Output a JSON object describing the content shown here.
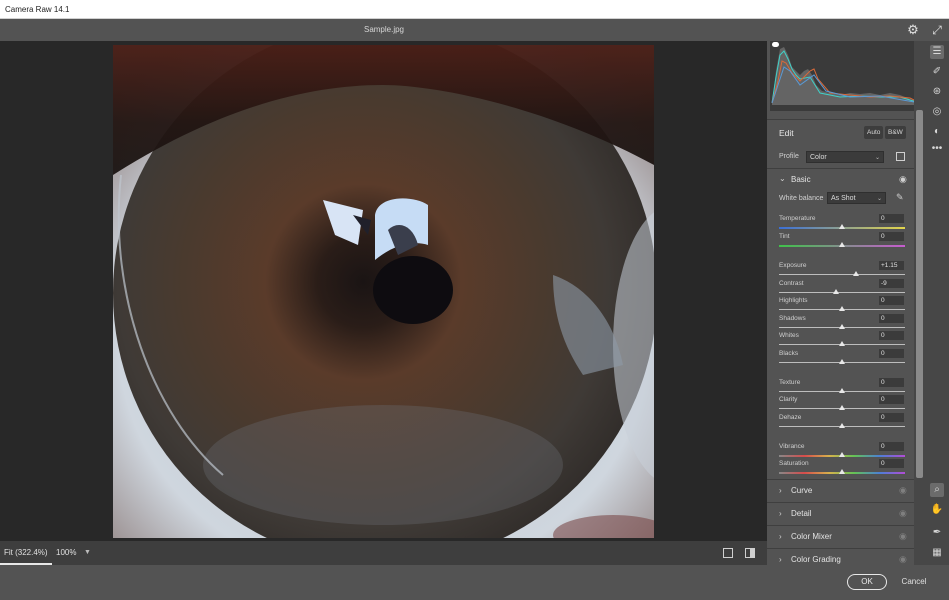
{
  "window": {
    "title": "Camera Raw 14.1"
  },
  "header": {
    "filename": "Sample.jpg",
    "settings_icon": "gear-icon",
    "fullscreen_icon": "expand-icon"
  },
  "bottombar": {
    "zoom_fit": "Fit (322.4%)",
    "zoom_level": "100%"
  },
  "footer": {
    "ok": "OK",
    "cancel": "Cancel"
  },
  "panel": {
    "edit_title": "Edit",
    "auto_label": "Auto",
    "bw_label": "B&W",
    "profile_label": "Profile",
    "profile_value": "Color",
    "basic_section": "Basic",
    "white_balance_label": "White balance",
    "white_balance_value": "As Shot",
    "sliders": [
      {
        "label": "Temperature",
        "value": "0",
        "pos": 0.5
      },
      {
        "label": "Tint",
        "value": "0",
        "pos": 0.5
      },
      {
        "label": "Exposure",
        "value": "+1.15",
        "pos": 0.615
      },
      {
        "label": "Contrast",
        "value": "-9",
        "pos": 0.455
      },
      {
        "label": "Highlights",
        "value": "0",
        "pos": 0.5
      },
      {
        "label": "Shadows",
        "value": "0",
        "pos": 0.5
      },
      {
        "label": "Whites",
        "value": "0",
        "pos": 0.5
      },
      {
        "label": "Blacks",
        "value": "0",
        "pos": 0.5
      },
      {
        "label": "Texture",
        "value": "0",
        "pos": 0.5
      },
      {
        "label": "Clarity",
        "value": "0",
        "pos": 0.5
      },
      {
        "label": "Dehaze",
        "value": "0",
        "pos": 0.5
      },
      {
        "label": "Vibrance",
        "value": "0",
        "pos": 0.5
      },
      {
        "label": "Saturation",
        "value": "0",
        "pos": 0.5
      }
    ],
    "collapsed_sections": [
      "Curve",
      "Detail",
      "Color Mixer",
      "Color Grading"
    ]
  }
}
